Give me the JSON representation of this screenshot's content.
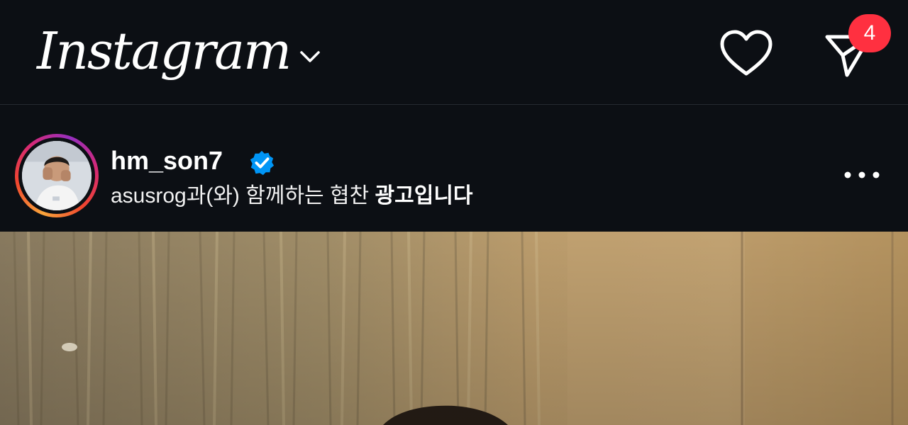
{
  "app": {
    "logo_text": "Instagram"
  },
  "header": {
    "notifications_icon": "heart-icon",
    "messages_icon": "paper-plane-icon",
    "messages_badge_count": "4",
    "switch_account_icon": "chevron-down-icon"
  },
  "post": {
    "username": "hm_son7",
    "verified_icon": "verified-badge-icon",
    "sponsor_brand": "asusrog",
    "sponsor_text_regular": "과(와) 함께하는 협찬",
    "sponsor_text_bold": "광고입니다",
    "more_icon": "more-horizontal-icon"
  },
  "colors": {
    "background": "#0c0f14",
    "badge": "#ff3040",
    "verified": "#0095f6"
  }
}
